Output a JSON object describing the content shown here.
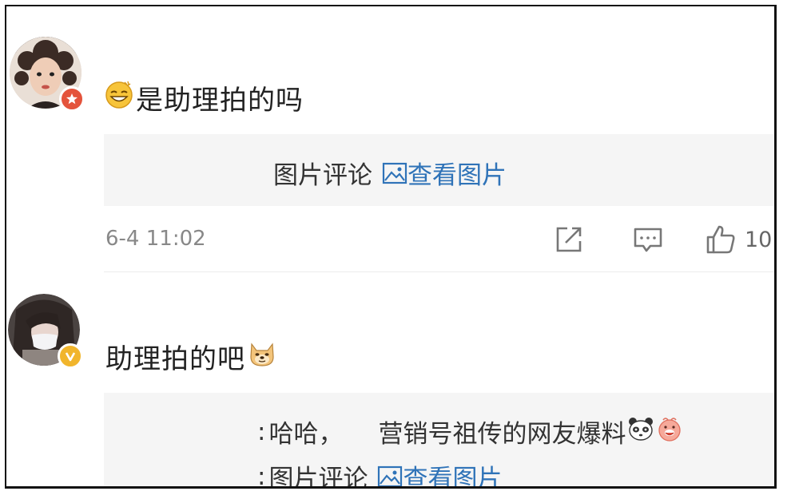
{
  "comments": [
    {
      "text": "是助理拍的吗",
      "reply": {
        "label": "图片评论",
        "view_picture": "查看图片"
      },
      "time": "6-4 11:02",
      "likes": "10"
    },
    {
      "text": "助理拍的吧",
      "reply": {
        "line1_prefix": ":",
        "line1_a": "哈哈，",
        "line1_b": "营销号祖传的网友爆料",
        "line2_prefix": ":",
        "label": "图片评论",
        "view_picture": "查看图片"
      }
    }
  ],
  "icons": {
    "share": "share-icon",
    "comment": "comment-icon",
    "like": "thumbs-up-icon",
    "view_picture": "image-icon"
  },
  "colors": {
    "link": "#2f73b8",
    "quote_bg": "#f5f5f5",
    "vip_badge": "#f1b52c",
    "red_badge": "#e4533b"
  }
}
